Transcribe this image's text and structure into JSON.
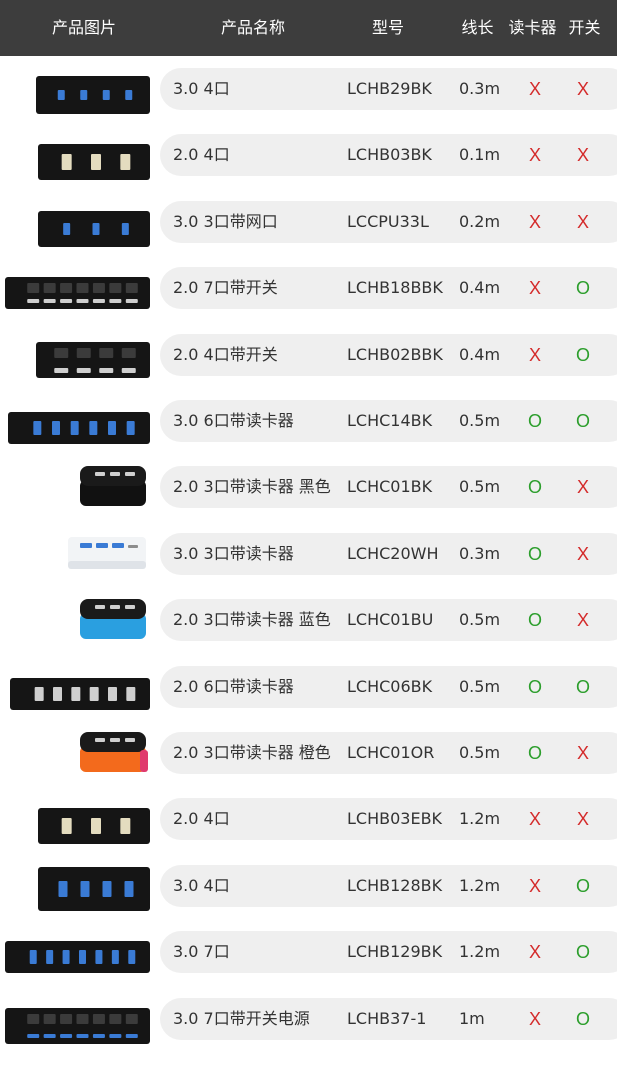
{
  "header": {
    "image": "产品图片",
    "name": "产品名称",
    "model": "型号",
    "length": "线长",
    "reader": "读卡器",
    "switch": "开关"
  },
  "rows": [
    {
      "name": "3.0 4口",
      "model": "LCHB29BK",
      "length": "0.3m",
      "reader": "X",
      "switch": "X",
      "thumb": "hub-slim-blue-4"
    },
    {
      "name": "2.0 4口",
      "model": "LCHB03BK",
      "length": "0.1m",
      "reader": "X",
      "switch": "X",
      "thumb": "hub-box-3"
    },
    {
      "name": "3.0 3口带网口",
      "model": "LCCPU33L",
      "length": "0.2m",
      "reader": "X",
      "switch": "X",
      "thumb": "hub-box-blue-3"
    },
    {
      "name": "2.0 7口带开关",
      "model": "LCHB18BBK",
      "length": "0.4m",
      "reader": "X",
      "switch": "O",
      "thumb": "hub-switch-7"
    },
    {
      "name": "2.0 4口带开关",
      "model": "LCHB02BBK",
      "length": "0.4m",
      "reader": "X",
      "switch": "O",
      "thumb": "hub-switch-4"
    },
    {
      "name": "3.0 6口带读卡器",
      "model": "LCHC14BK",
      "length": "0.5m",
      "reader": "O",
      "switch": "O",
      "thumb": "hub-long-blue-6"
    },
    {
      "name": "2.0 3口带读卡器 黑色",
      "model": "LCHC01BK",
      "length": "0.5m",
      "reader": "O",
      "switch": "X",
      "thumb": "cube-black"
    },
    {
      "name": "3.0 3口带读卡器",
      "model": "LCHC20WH",
      "length": "0.3m",
      "reader": "O",
      "switch": "X",
      "thumb": "hub-white"
    },
    {
      "name": "2.0 3口带读卡器 蓝色",
      "model": "LCHC01BU",
      "length": "0.5m",
      "reader": "O",
      "switch": "X",
      "thumb": "cube-blue"
    },
    {
      "name": "2.0 6口带读卡器",
      "model": "LCHC06BK",
      "length": "0.5m",
      "reader": "O",
      "switch": "O",
      "thumb": "hub-long-6"
    },
    {
      "name": "2.0 3口带读卡器 橙色",
      "model": "LCHC01OR",
      "length": "0.5m",
      "reader": "O",
      "switch": "X",
      "thumb": "cube-orange"
    },
    {
      "name": "2.0 4口",
      "model": "LCHB03EBK",
      "length": "1.2m",
      "reader": "X",
      "switch": "X",
      "thumb": "hub-box-3"
    },
    {
      "name": "3.0 4口",
      "model": "LCHB128BK",
      "length": "1.2m",
      "reader": "X",
      "switch": "O",
      "thumb": "hub-box-blue-4"
    },
    {
      "name": "3.0 7口",
      "model": "LCHB129BK",
      "length": "1.2m",
      "reader": "X",
      "switch": "O",
      "thumb": "hub-long-blue-7"
    },
    {
      "name": "3.0 7口带开关电源",
      "model": "LCHB37-1",
      "length": "1m",
      "reader": "X",
      "switch": "O",
      "thumb": "hub-switch-blue-7"
    }
  ],
  "colors": {
    "header_bg": "#3d3d3d",
    "pill_bg": "#efefef",
    "x_mark": "#d42b2b",
    "o_mark": "#2c9e2c"
  }
}
